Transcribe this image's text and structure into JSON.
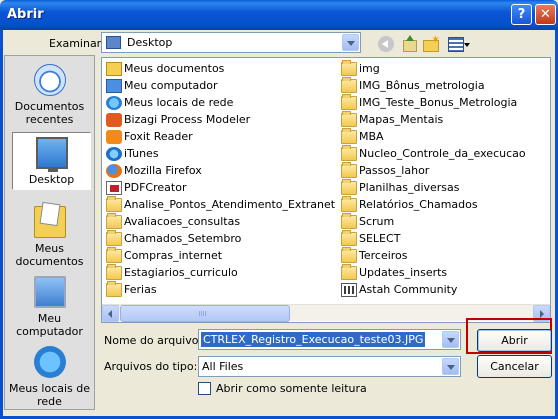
{
  "window": {
    "title": "Abrir",
    "help_label": "?",
    "close_label": "✕"
  },
  "toolbar": {
    "look_in_label": "Examinar:",
    "look_in_value": "Desktop"
  },
  "places": [
    {
      "label": "Documentos recentes",
      "icon": "recent-documents-icon"
    },
    {
      "label": "Desktop",
      "icon": "desktop-icon",
      "selected": true
    },
    {
      "label": "Meus documentos",
      "icon": "my-documents-icon"
    },
    {
      "label": "Meu computador",
      "icon": "my-computer-icon"
    },
    {
      "label": "Meus locais de rede",
      "icon": "network-places-icon"
    }
  ],
  "files_left": [
    {
      "name": "Meus documentos",
      "icon": "my-documents-icon"
    },
    {
      "name": "Meu computador",
      "icon": "my-computer-icon"
    },
    {
      "name": "Meus locais de rede",
      "icon": "network-places-icon"
    },
    {
      "name": "Bizagi Process Modeler",
      "icon": "bizagi-icon"
    },
    {
      "name": "Foxit Reader",
      "icon": "foxit-icon"
    },
    {
      "name": "iTunes",
      "icon": "itunes-icon"
    },
    {
      "name": "Mozilla Firefox",
      "icon": "firefox-icon"
    },
    {
      "name": "PDFCreator",
      "icon": "pdfcreator-icon"
    },
    {
      "name": "Analise_Pontos_Atendimento_Extranet",
      "icon": "folder-icon"
    },
    {
      "name": "Avaliacoes_consultas",
      "icon": "folder-icon"
    },
    {
      "name": "Chamados_Setembro",
      "icon": "folder-icon"
    },
    {
      "name": "Compras_internet",
      "icon": "folder-icon"
    },
    {
      "name": "Estagiarios_curriculo",
      "icon": "folder-icon"
    },
    {
      "name": "Ferias",
      "icon": "folder-icon"
    }
  ],
  "files_right": [
    {
      "name": "img",
      "icon": "folder-icon"
    },
    {
      "name": "IMG_Bônus_metrologia",
      "icon": "folder-icon"
    },
    {
      "name": "IMG_Teste_Bonus_Metrologia",
      "icon": "folder-icon"
    },
    {
      "name": "Mapas_Mentais",
      "icon": "folder-icon"
    },
    {
      "name": "MBA",
      "icon": "folder-icon"
    },
    {
      "name": "Nucleo_Controle_da_execucao",
      "icon": "folder-icon"
    },
    {
      "name": "Passos_lahor",
      "icon": "folder-icon"
    },
    {
      "name": "Planilhas_diversas",
      "icon": "folder-icon"
    },
    {
      "name": "Relatórios_Chamados",
      "icon": "folder-icon"
    },
    {
      "name": "Scrum",
      "icon": "folder-icon"
    },
    {
      "name": "SELECT",
      "icon": "folder-icon"
    },
    {
      "name": "Terceiros",
      "icon": "folder-icon"
    },
    {
      "name": "Updates_inserts",
      "icon": "folder-icon"
    },
    {
      "name": "Astah Community",
      "icon": "astah-icon"
    }
  ],
  "form": {
    "filename_label": "Nome do arquivo:",
    "filename_value": "CTRLEX_Registro_Execucao_teste03.JPG",
    "filetype_label": "Arquivos do tipo:",
    "filetype_value": "All Files",
    "readonly_label": "Abrir como somente leitura",
    "readonly_checked": false
  },
  "buttons": {
    "open_label": "Abrir",
    "cancel_label": "Cancelar"
  },
  "colors": {
    "titlebar": "#0650cc",
    "highlight_box": "#c00000",
    "selection": "#316ac5"
  }
}
